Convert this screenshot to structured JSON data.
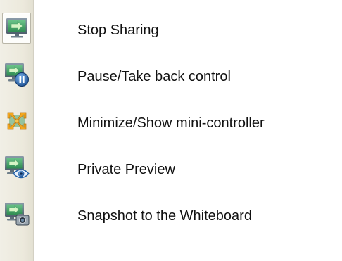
{
  "toolbar": {
    "items": [
      {
        "label": "Stop Sharing",
        "icon": "monitor-arrow-icon",
        "active": true
      },
      {
        "label": "Pause/Take back control",
        "icon": "monitor-pause-icon",
        "active": false
      },
      {
        "label": "Minimize/Show mini-controller",
        "icon": "minimize-arrows-icon",
        "active": false
      },
      {
        "label": "Private Preview",
        "icon": "monitor-eye-icon",
        "active": false
      },
      {
        "label": "Snapshot to the Whiteboard",
        "icon": "monitor-camera-icon",
        "active": false
      }
    ]
  },
  "colors": {
    "toolbar_bg": "#ece9dc",
    "screen_green": "#3b9b5a",
    "arrow_light": "#c9f0b7",
    "badge_blue": "#1f5fa8",
    "star_orange": "#f3a81f"
  }
}
